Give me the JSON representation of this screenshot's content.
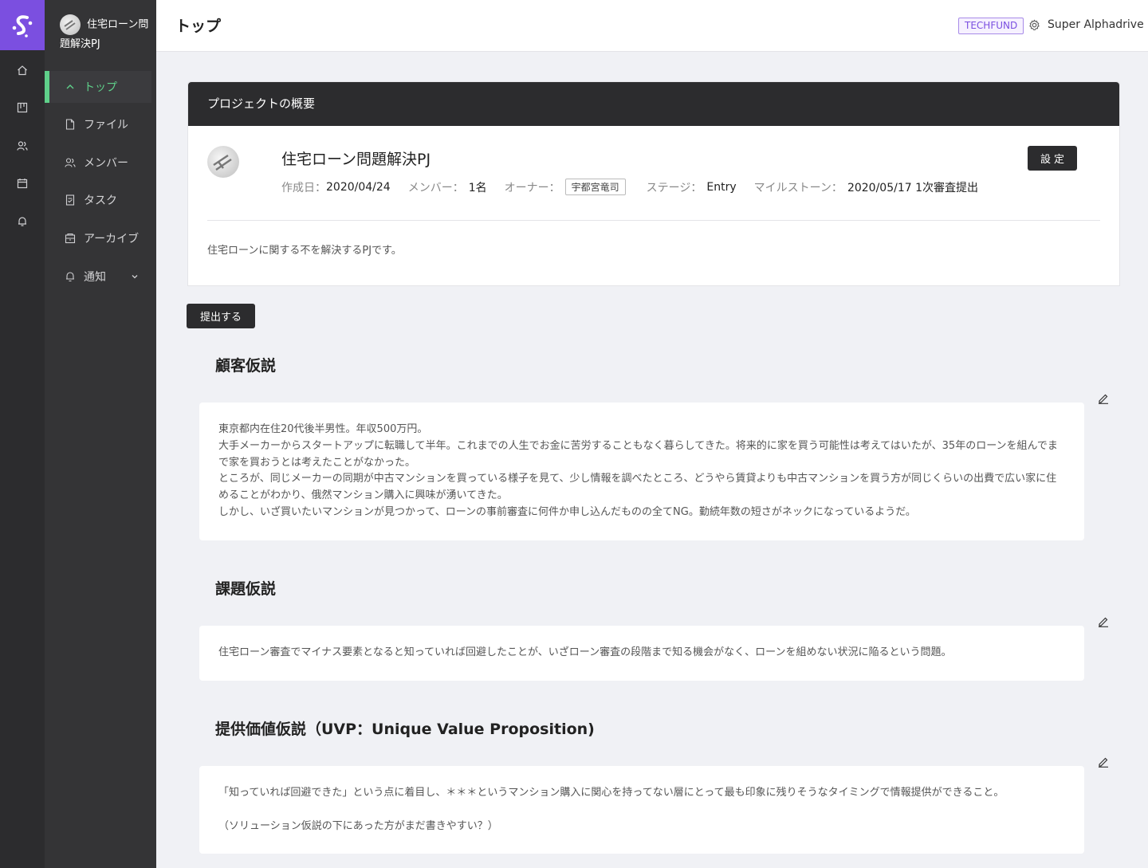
{
  "app": {
    "brand_color": "#7b4fe0",
    "accent_color": "#5fd08a"
  },
  "rail": {
    "icons": [
      "logo-icon",
      "home-icon",
      "board-icon",
      "people-icon",
      "calendar-icon",
      "bell-icon"
    ]
  },
  "sidebar": {
    "project_title": "住宅ローン問題解決PJ",
    "items": [
      {
        "label": "トップ",
        "icon": "chevron-up-icon",
        "active": true
      },
      {
        "label": "ファイル",
        "icon": "file-icon"
      },
      {
        "label": "メンバー",
        "icon": "members-icon"
      },
      {
        "label": "タスク",
        "icon": "task-icon"
      },
      {
        "label": "アーカイブ",
        "icon": "archive-icon"
      },
      {
        "label": "通知",
        "icon": "bell-icon"
      }
    ]
  },
  "header": {
    "title": "トップ",
    "org_badge": "TECHFUND",
    "user_name": "Super Alphadrive"
  },
  "overview": {
    "heading": "プロジェクトの概要",
    "project_name": "住宅ローン問題解決PJ",
    "created_label": "作成日：",
    "created_value": "2020/04/24",
    "members_label": "メンバー：",
    "members_value": "1名",
    "owner_label": "オーナー：",
    "owner_value": "宇都宮竜司",
    "stage_label": "ステージ：",
    "stage_value": "Entry",
    "milestone_label": "マイルストーン：",
    "milestone_value": "2020/05/17 1次審査提出",
    "settings_label": "設定",
    "description": "住宅ローンに関する不を解決するPJです。"
  },
  "submit_label": "提出する",
  "sections": [
    {
      "title": "顧客仮説",
      "lines": [
        "東京都内在住20代後半男性。年収500万円。",
        "大手メーカーからスタートアップに転職して半年。これまでの人生でお金に苦労することもなく暮らしてきた。将来的に家を買う可能性は考えてはいたが、35年のローンを組んでまで家を買おうとは考えたことがなかった。",
        "ところが、同じメーカーの同期が中古マンションを買っている様子を見て、少し情報を調べたところ、どうやら賃貸よりも中古マンションを買う方が同じくらいの出費で広い家に住めることがわかり、俄然マンション購入に興味が湧いてきた。",
        "しかし、いざ買いたいマンションが見つかって、ローンの事前審査に何件か申し込んだものの全てNG。勤続年数の短さがネックになっているようだ。"
      ]
    },
    {
      "title": "課題仮説",
      "lines": [
        "住宅ローン審査でマイナス要素となると知っていれば回避したことが、いざローン審査の段階まで知る機会がなく、ローンを組めない状況に陥るという問題。"
      ]
    },
    {
      "title": "提供価値仮説（UVP：Unique Value Proposition)",
      "lines": [
        "「知っていれば回避できた」という点に着目し、＊＊＊というマンション購入に関心を持ってない層にとって最も印象に残りそうなタイミングで情報提供ができること。",
        "",
        "（ソリューション仮説の下にあった方がまだ書きやすい？）"
      ]
    }
  ]
}
